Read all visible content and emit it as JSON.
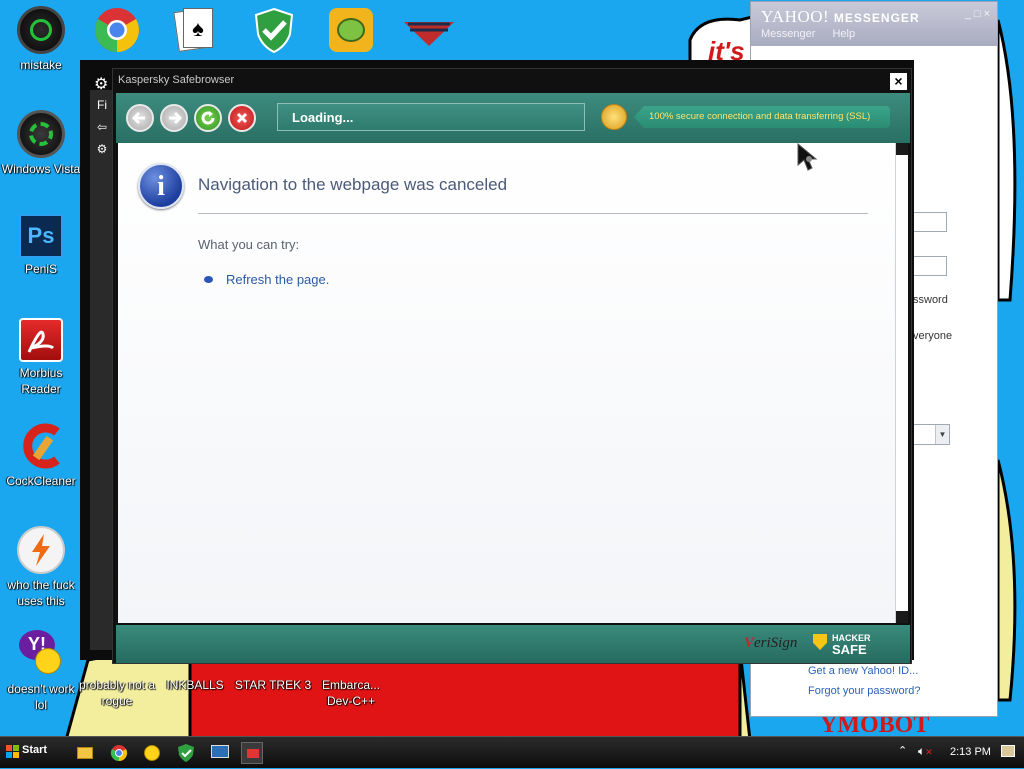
{
  "desktop": {
    "background_text_top": "it's",
    "background_text_bottom": "YMOBOT",
    "icons": [
      {
        "label": "mistake"
      },
      {
        "label": "Windows Vista"
      },
      {
        "label": "PeniS"
      },
      {
        "label": "Morbius Reader"
      },
      {
        "label": "CockCleaner"
      },
      {
        "label": "who the fuck uses this"
      },
      {
        "label": "doesn't work lol"
      },
      {
        "label": "probably not a rogue"
      },
      {
        "label": "INKBALLS"
      },
      {
        "label": "STAR TREK 3"
      },
      {
        "label": "Embarca... Dev-C++"
      }
    ],
    "ps_icon_text": "Ps"
  },
  "yahoo": {
    "logo": "YAHOO!",
    "product": "MESSENGER",
    "menu": [
      "Messenger",
      "Help"
    ],
    "password_fragment": "ssword",
    "everyone_fragment": "veryone",
    "link_new_id": "Get a new Yahoo! ID...",
    "link_forgot": "Forgot your password?"
  },
  "kaspersky": {
    "title": "Kaspersky Safebrowser",
    "close_glyph": "×",
    "side_label": "Fi",
    "url_status": "Loading...",
    "ssl_text": "100% secure connection and data transferring (SSL)",
    "page": {
      "heading": "Navigation to the webpage was canceled",
      "try_label": "What you can try:",
      "action": "Refresh the page."
    },
    "footer": {
      "verisign_v": "V",
      "verisign_rest": "eriSign",
      "hacker_top": "HACKER",
      "hacker_bottom": "SAFE"
    }
  },
  "taskbar": {
    "start_label": "Start",
    "clock": "2:13 PM"
  }
}
